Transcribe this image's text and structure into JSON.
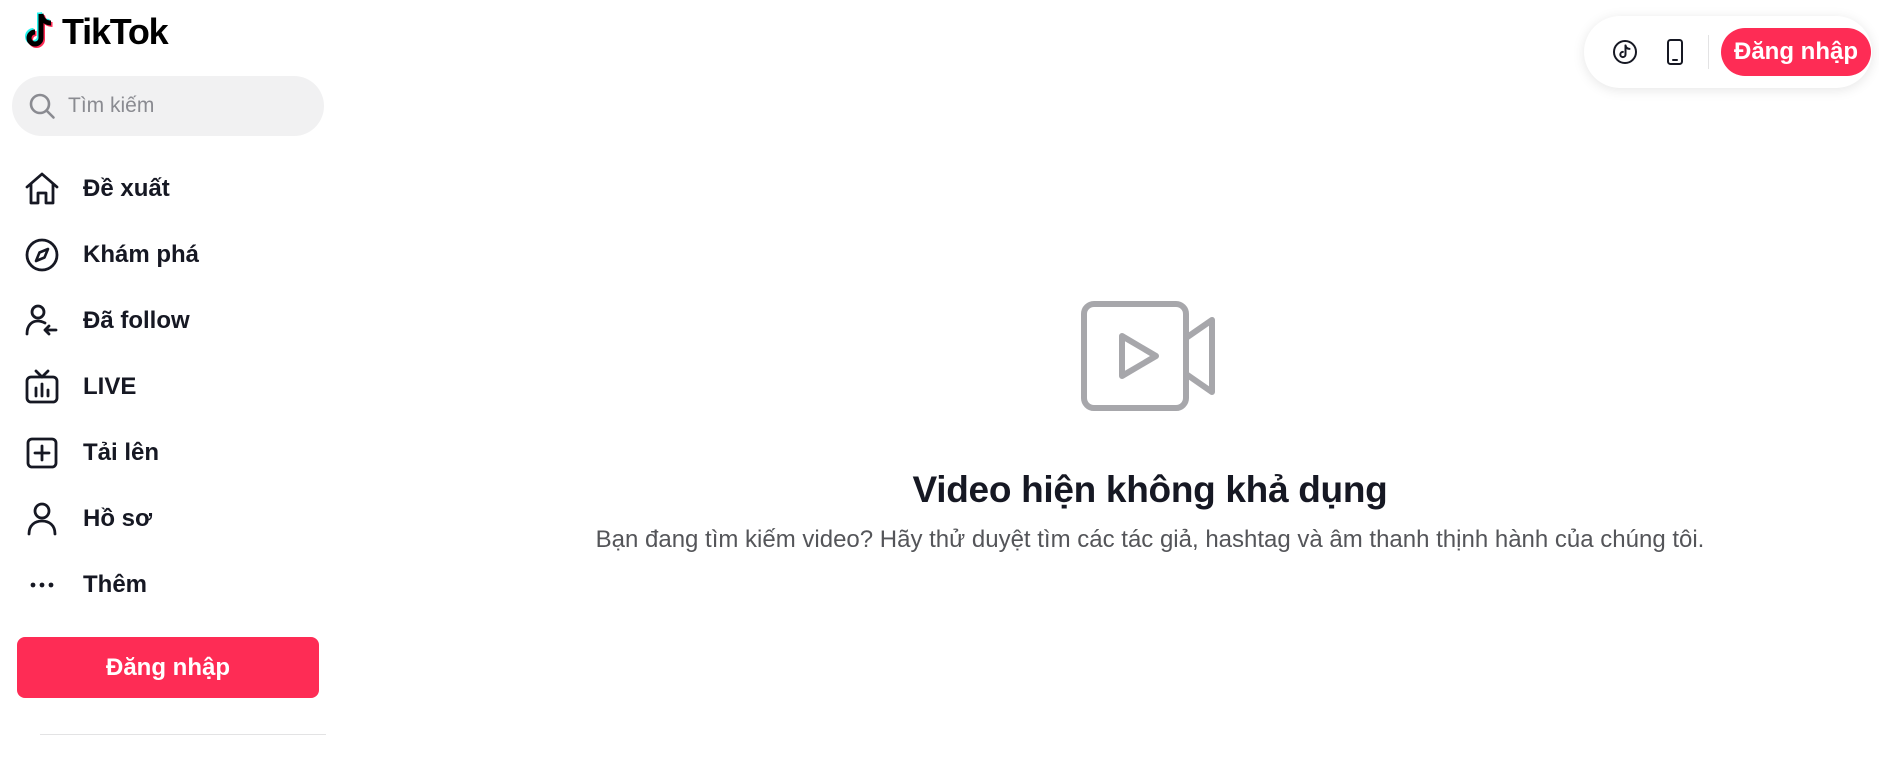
{
  "brand": {
    "name": "TikTok",
    "accent": "#fe2c55",
    "logo_cyan": "#25f4ee",
    "logo_red": "#fe2c55"
  },
  "search": {
    "placeholder": "Tìm kiếm",
    "icon": "search-icon"
  },
  "nav": {
    "items": [
      {
        "label": "Đề xuất",
        "icon": "home-icon"
      },
      {
        "label": "Khám phá",
        "icon": "compass-icon"
      },
      {
        "label": "Đã follow",
        "icon": "user-follow-icon"
      },
      {
        "label": "LIVE",
        "icon": "live-tv-icon"
      },
      {
        "label": "Tải lên",
        "icon": "upload-plus-icon"
      },
      {
        "label": "Hồ sơ",
        "icon": "profile-icon"
      },
      {
        "label": "Thêm",
        "icon": "more-icon"
      }
    ]
  },
  "sidebar": {
    "login_label": "Đăng nhập"
  },
  "header": {
    "tiktok_icon": "tiktok-icon",
    "mobile_icon": "mobile-icon",
    "login_label": "Đăng nhập"
  },
  "main": {
    "icon": "video-camera-icon",
    "title": "Video hiện không khả dụng",
    "description": "Bạn đang tìm kiếm video? Hãy thử duyệt tìm các tác giả, hashtag và âm thanh thịnh hành của chúng tôi."
  }
}
